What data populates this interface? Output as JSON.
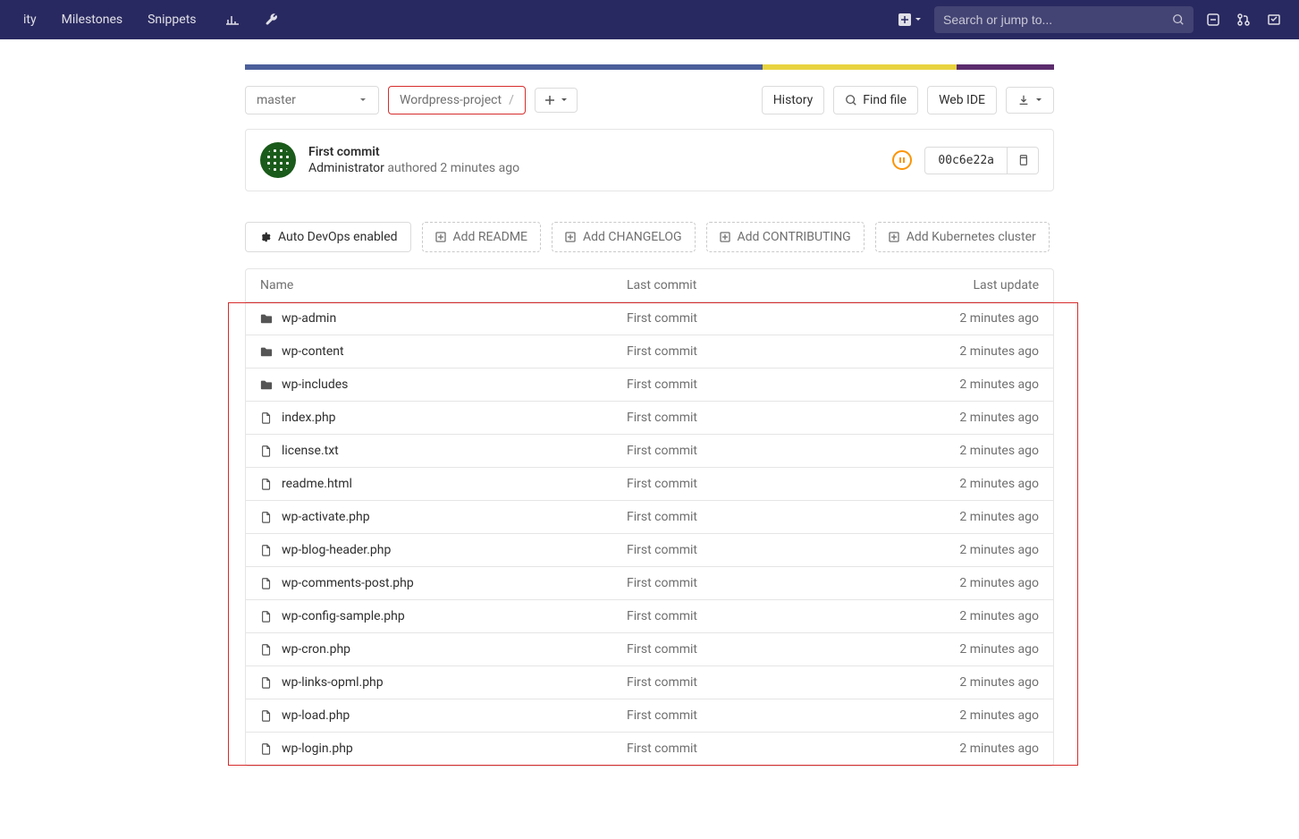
{
  "navbar": {
    "items": [
      "ity",
      "Milestones",
      "Snippets"
    ],
    "search_placeholder": "Search or jump to..."
  },
  "branch": "master",
  "breadcrumb": {
    "project": "Wordpress-project"
  },
  "actions": {
    "history": "History",
    "find_file": "Find file",
    "web_ide": "Web IDE"
  },
  "commit": {
    "title": "First commit",
    "author": "Administrator",
    "meta": "authored 2 minutes ago",
    "sha": "00c6e22a"
  },
  "suggestions": {
    "auto_devops": "Auto DevOps enabled",
    "add_readme": "Add README",
    "add_changelog": "Add CHANGELOG",
    "add_contributing": "Add CONTRIBUTING",
    "add_k8s": "Add Kubernetes cluster"
  },
  "table": {
    "headers": {
      "name": "Name",
      "last_commit": "Last commit",
      "last_update": "Last update"
    },
    "rows": [
      {
        "type": "folder",
        "name": "wp-admin",
        "commit": "First commit",
        "update": "2 minutes ago"
      },
      {
        "type": "folder",
        "name": "wp-content",
        "commit": "First commit",
        "update": "2 minutes ago"
      },
      {
        "type": "folder",
        "name": "wp-includes",
        "commit": "First commit",
        "update": "2 minutes ago"
      },
      {
        "type": "file",
        "name": "index.php",
        "commit": "First commit",
        "update": "2 minutes ago"
      },
      {
        "type": "file",
        "name": "license.txt",
        "commit": "First commit",
        "update": "2 minutes ago"
      },
      {
        "type": "file",
        "name": "readme.html",
        "commit": "First commit",
        "update": "2 minutes ago"
      },
      {
        "type": "file",
        "name": "wp-activate.php",
        "commit": "First commit",
        "update": "2 minutes ago"
      },
      {
        "type": "file",
        "name": "wp-blog-header.php",
        "commit": "First commit",
        "update": "2 minutes ago"
      },
      {
        "type": "file",
        "name": "wp-comments-post.php",
        "commit": "First commit",
        "update": "2 minutes ago"
      },
      {
        "type": "file",
        "name": "wp-config-sample.php",
        "commit": "First commit",
        "update": "2 minutes ago"
      },
      {
        "type": "file",
        "name": "wp-cron.php",
        "commit": "First commit",
        "update": "2 minutes ago"
      },
      {
        "type": "file",
        "name": "wp-links-opml.php",
        "commit": "First commit",
        "update": "2 minutes ago"
      },
      {
        "type": "file",
        "name": "wp-load.php",
        "commit": "First commit",
        "update": "2 minutes ago"
      },
      {
        "type": "file",
        "name": "wp-login.php",
        "commit": "First commit",
        "update": "2 minutes ago"
      }
    ]
  }
}
